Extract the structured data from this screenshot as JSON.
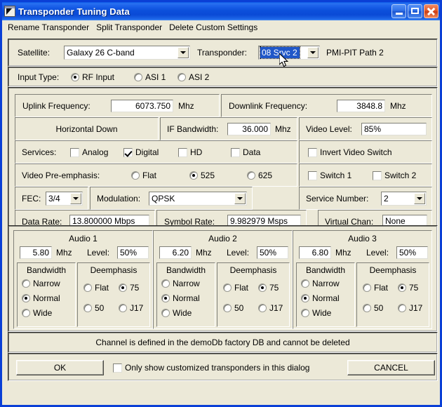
{
  "window": {
    "title": "Transponder Tuning Data",
    "icon": "app-icon",
    "buttons": {
      "minimize": "minimize",
      "maximize": "maximize",
      "close": "close"
    }
  },
  "menubar": {
    "items": [
      {
        "label": "Rename Transponder"
      },
      {
        "label": "Split Transponder"
      },
      {
        "label": "Delete Custom Settings"
      }
    ]
  },
  "selector": {
    "satellite_label": "Satellite:",
    "satellite_value": "Galaxy 26  C-band",
    "transponder_label": "Transponder:",
    "transponder_value": "08 Srvc 2",
    "path_label": "PMI-PIT Path 2"
  },
  "input_type": {
    "label": "Input Type:",
    "options": [
      {
        "label": "RF Input",
        "selected": true
      },
      {
        "label": "ASI 1",
        "selected": false
      },
      {
        "label": "ASI 2",
        "selected": false
      }
    ]
  },
  "frequencies": {
    "uplink_label": "Uplink Frequency:",
    "uplink_value": "6073.750",
    "uplink_unit": "Mhz",
    "downlink_label": "Downlink Frequency:",
    "downlink_value": "3848.8",
    "downlink_unit": "Mhz"
  },
  "polarization": {
    "label": "Horizontal Down"
  },
  "if_bandwidth": {
    "label": "IF Bandwidth:",
    "value": "36.000",
    "unit": "Mhz"
  },
  "video_level": {
    "label": "Video Level:",
    "value": "85%"
  },
  "services": {
    "label": "Services:",
    "items": [
      {
        "label": "Analog",
        "checked": false
      },
      {
        "label": "Digital",
        "checked": true
      },
      {
        "label": "HD",
        "checked": false
      },
      {
        "label": "Data",
        "checked": false
      }
    ],
    "invert_video_switch": {
      "label": "Invert Video Switch",
      "checked": false
    }
  },
  "video_preemphasis": {
    "label": "Video Pre-emphasis:",
    "options": [
      {
        "label": "Flat",
        "selected": false
      },
      {
        "label": "525",
        "selected": true
      },
      {
        "label": "625",
        "selected": false
      }
    ],
    "switches": [
      {
        "label": "Switch 1",
        "checked": false
      },
      {
        "label": "Switch 2",
        "checked": false
      }
    ]
  },
  "modulation_row": {
    "fec_label": "FEC:",
    "fec_value": "3/4",
    "modulation_label": "Modulation:",
    "modulation_value": "QPSK",
    "service_number_label": "Service Number:",
    "service_number_value": "2"
  },
  "rates_row": {
    "data_rate_label": "Data Rate:",
    "data_rate_value": "13.800000 Mbps",
    "symbol_rate_label": "Symbol Rate:",
    "symbol_rate_value": "9.982979 Msps",
    "virtual_chan_label": "Virtual Chan:",
    "virtual_chan_value": "None"
  },
  "audio": [
    {
      "title": "Audio 1",
      "freq": "5.80",
      "unit": "Mhz",
      "level_label": "Level:",
      "level": "50%",
      "bandwidth_label": "Bandwidth",
      "bandwidth": [
        {
          "label": "Narrow",
          "selected": false
        },
        {
          "label": "Normal",
          "selected": true
        },
        {
          "label": "Wide",
          "selected": false
        }
      ],
      "deemphasis_label": "Deemphasis",
      "deemphasis": [
        {
          "label": "Flat",
          "selected": false
        },
        {
          "label": "75",
          "selected": true
        },
        {
          "label": "50",
          "selected": false
        },
        {
          "label": "J17",
          "selected": false
        }
      ]
    },
    {
      "title": "Audio 2",
      "freq": "6.20",
      "unit": "Mhz",
      "level_label": "Level:",
      "level": "50%",
      "bandwidth_label": "Bandwidth",
      "bandwidth": [
        {
          "label": "Narrow",
          "selected": false
        },
        {
          "label": "Normal",
          "selected": true
        },
        {
          "label": "Wide",
          "selected": false
        }
      ],
      "deemphasis_label": "Deemphasis",
      "deemphasis": [
        {
          "label": "Flat",
          "selected": false
        },
        {
          "label": "75",
          "selected": true
        },
        {
          "label": "50",
          "selected": false
        },
        {
          "label": "J17",
          "selected": false
        }
      ]
    },
    {
      "title": "Audio 3",
      "freq": "6.80",
      "unit": "Mhz",
      "level_label": "Level:",
      "level": "50%",
      "bandwidth_label": "Bandwidth",
      "bandwidth": [
        {
          "label": "Narrow",
          "selected": false
        },
        {
          "label": "Normal",
          "selected": true
        },
        {
          "label": "Wide",
          "selected": false
        }
      ],
      "deemphasis_label": "Deemphasis",
      "deemphasis": [
        {
          "label": "Flat",
          "selected": false
        },
        {
          "label": "75",
          "selected": true
        },
        {
          "label": "50",
          "selected": false
        },
        {
          "label": "J17",
          "selected": false
        }
      ]
    }
  ],
  "status": {
    "message": "Channel is defined in the demoDb factory DB and cannot be deleted"
  },
  "footer": {
    "ok_label": "OK",
    "cancel_label": "CANCEL",
    "filter_checkbox": {
      "label": "Only show customized transponders  in this dialog",
      "checked": false
    }
  },
  "colors": {
    "titlebar_blue": "#0c50dc",
    "window_border": "#0a3fd6",
    "face": "#ece9d8",
    "selection_blue": "#2057c8",
    "close_red": "#c93c16"
  }
}
